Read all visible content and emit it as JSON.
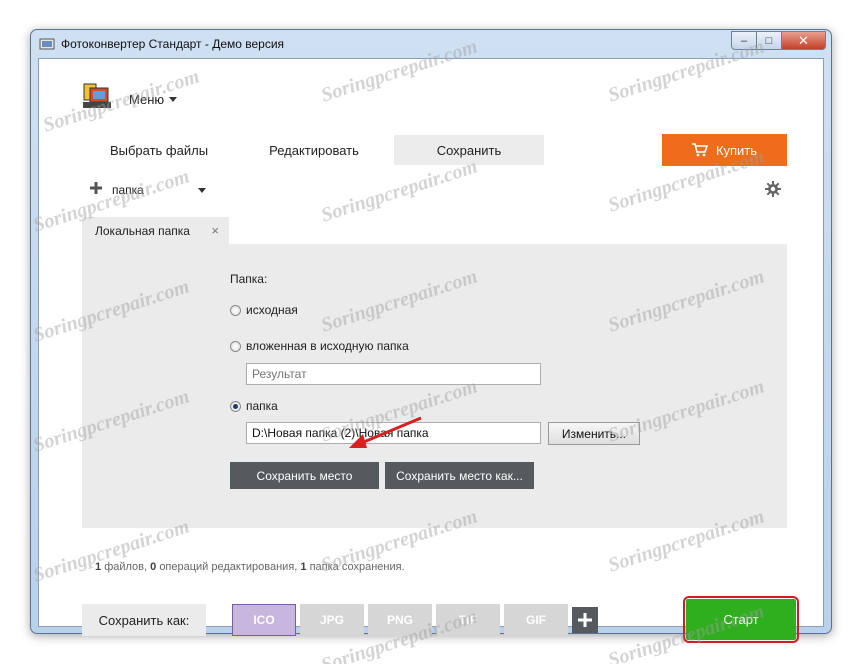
{
  "window": {
    "title": "Фотоконвертер Стандарт - Демо версия",
    "close_glyph": "✕",
    "max_glyph": "□",
    "min_glyph": "–"
  },
  "menu": {
    "label": "Меню"
  },
  "tabs": {
    "select_files": "Выбрать файлы",
    "edit": "Редактировать",
    "save": "Сохранить",
    "active": "save"
  },
  "buy": {
    "label": "Купить"
  },
  "toolbar": {
    "folder_dropdown": "папка"
  },
  "panel": {
    "tab_label": "Локальная папка",
    "tab_close": "×",
    "folder_label": "Папка:",
    "option_source": "исходная",
    "option_subfolder": "вложенная в исходную папка",
    "subfolder_placeholder": "Результат",
    "option_folder": "папка",
    "selected_option": "folder",
    "path_value": "D:\\Новая папка (2)\\Новая папка",
    "change_button": "Изменить...",
    "save_place_button": "Сохранить место",
    "save_place_as_button": "Сохранить место как..."
  },
  "status": {
    "files_count": "1",
    "files_text": "файлов,",
    "ops_count": "0",
    "ops_text": "операций редактирования,",
    "folders_count": "1",
    "folders_text": "папка сохранения."
  },
  "bottom": {
    "save_as_label": "Сохранить как:",
    "formats": [
      "ICO",
      "JPG",
      "PNG",
      "TIF",
      "GIF"
    ],
    "active_format": "ICO",
    "start_button": "Старт"
  },
  "watermark": "Soringpcrepair.com",
  "colors": {
    "buy": "#ef6c1b",
    "start": "#2fae1e",
    "highlight": "#cc2020",
    "active_format": "#c8b6df",
    "dark_button": "#555a5e"
  },
  "icons": [
    "app-icon",
    "menu-logo-icon",
    "caret-down-icon",
    "cart-icon",
    "plus-icon",
    "gear-icon",
    "close-icon",
    "red-arrow-annotation"
  ]
}
